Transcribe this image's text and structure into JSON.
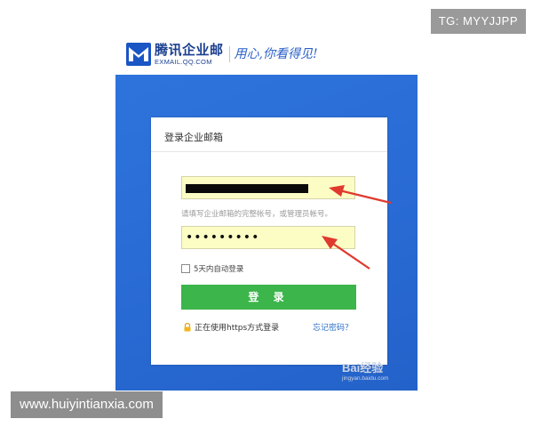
{
  "badges": {
    "telegram": "TG: MYYJJPP",
    "site": "www.huiyintianxia.com"
  },
  "brand": {
    "name": "腾讯企业邮",
    "domain": "EXMAIL.QQ.COM",
    "slogan": "用心,你看得见!"
  },
  "login": {
    "title": "登录企业邮箱",
    "account_hint": "请填写企业邮箱的完整帐号，或管理员帐号。",
    "password_mask": "•••••••••",
    "auto_login_label": "5天内自动登录",
    "login_button": "登 录",
    "https_label": "正在使用https方式登录",
    "forgot_password": "忘记密码？"
  },
  "watermark": {
    "logo": "Bai经验",
    "url": "jingyan.baidu.com"
  },
  "colors": {
    "banner_blue": "#2a6cd6",
    "input_yellow": "#fbfdc4",
    "button_green": "#3cb54a",
    "link_blue": "#2b6fc8",
    "arrow_red": "#e03a2f"
  },
  "icons": {
    "brand_mark": "mail-envelope-icon",
    "lock": "lock-icon",
    "checkbox": "checkbox-icon",
    "arrows": "red-arrow-icon"
  }
}
